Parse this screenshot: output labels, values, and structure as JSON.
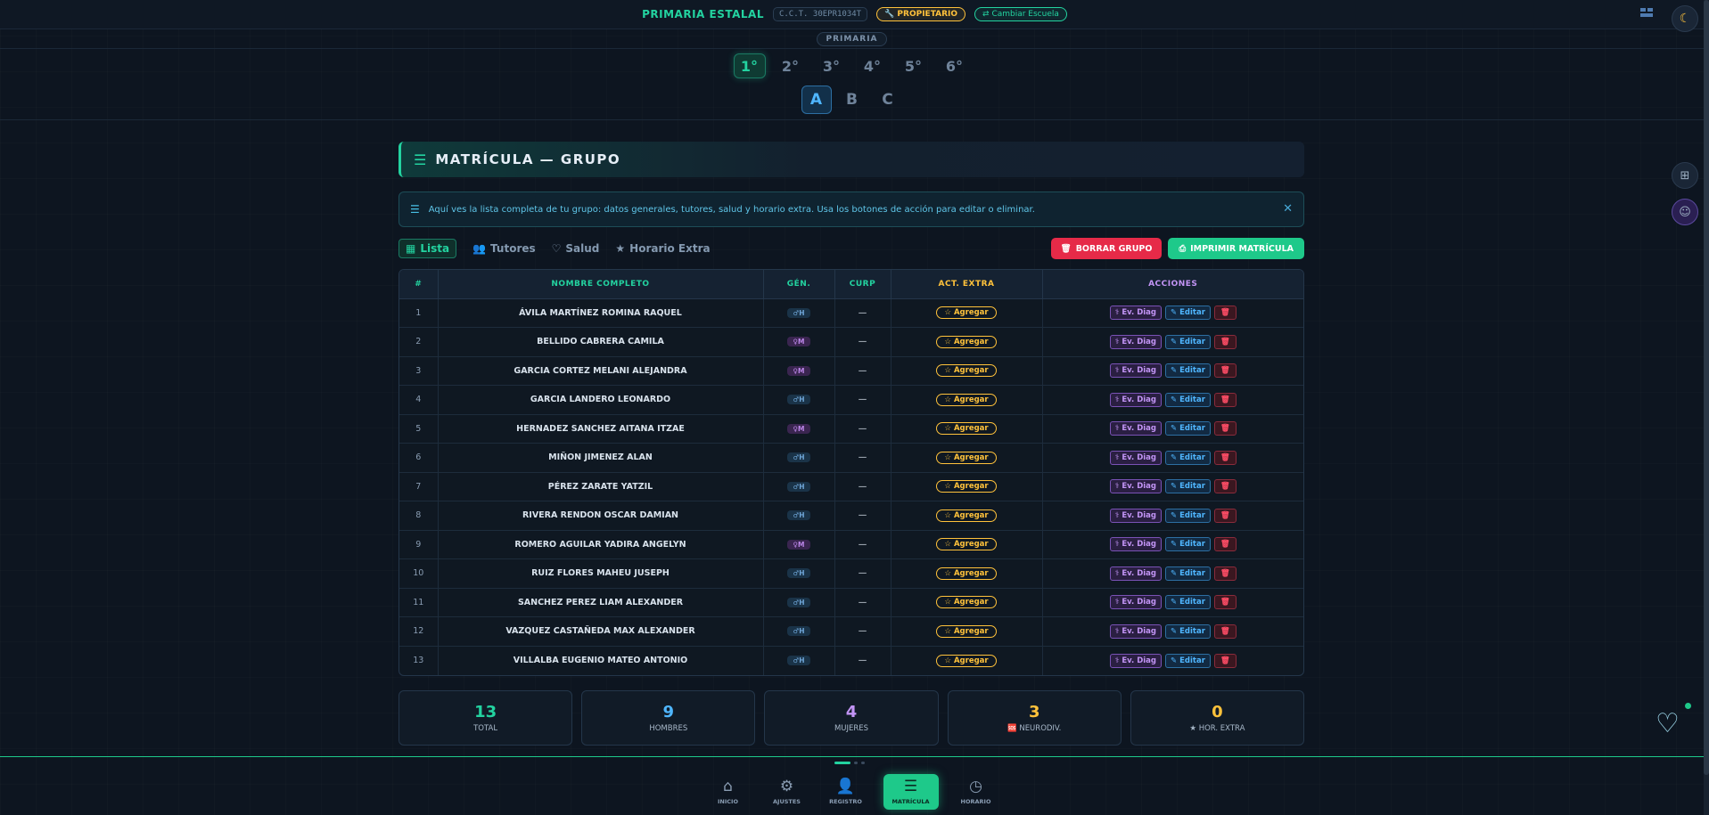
{
  "header": {
    "school_name": "PRIMARIA ESTALAL",
    "cct": "C.C.T. 30EPR1034T",
    "role": "🔧 PROPIETARIO",
    "change_school": "⇄ Cambiar Escuela",
    "theme_icon": "moon-icon"
  },
  "level": "PRIMARIA",
  "grades": [
    "1°",
    "2°",
    "3°",
    "4°",
    "5°",
    "6°"
  ],
  "groups": [
    "A",
    "B",
    "C"
  ],
  "section": {
    "title": "MATRÍCULA — GRUPO",
    "info": "Aquí ves la lista completa de tu grupo: datos generales, tutores, salud y horario extra. Usa los botones de acción para editar o eliminar."
  },
  "tabs": [
    {
      "label": "Lista",
      "icon": "table-icon"
    },
    {
      "label": "Tutores",
      "icon": "users-icon"
    },
    {
      "label": "Salud",
      "icon": "heart-pulse-icon"
    },
    {
      "label": "Horario Extra",
      "icon": "star-icon"
    }
  ],
  "actions": {
    "delete_group": "BORRAR GRUPO",
    "print": "IMPRIMIR MATRÍCULA"
  },
  "table": {
    "headers": [
      "#",
      "NOMBRE COMPLETO",
      "GÉN.",
      "CURP",
      "ACT. EXTRA",
      "ACCIONES"
    ],
    "header_colors": [
      "#23d3a0",
      "#23d3a0",
      "#23d3a0",
      "#23d3a0",
      "#ffc23b",
      "#c294f5"
    ],
    "add_label": "☆ Agregar",
    "ev_label": "Ev. Diag",
    "edit_label": "Editar",
    "rows": [
      {
        "num": "1",
        "name": "ÁVILA MARTÍNEZ ROMINA RAQUEL",
        "gen": "♂H",
        "curp": "—"
      },
      {
        "num": "2",
        "name": "BELLIDO CABRERA CAMILA",
        "gen": "♀M",
        "curp": "—"
      },
      {
        "num": "3",
        "name": "GARCIA CORTEZ MELANI ALEJANDRA",
        "gen": "♀M",
        "curp": "—"
      },
      {
        "num": "4",
        "name": "GARCIA LANDERO LEONARDO",
        "gen": "♂H",
        "curp": "—"
      },
      {
        "num": "5",
        "name": "HERNADEZ SANCHEZ AITANA ITZAE",
        "gen": "♀M",
        "curp": "—"
      },
      {
        "num": "6",
        "name": "MIÑON JIMENEZ ALAN",
        "gen": "♂H",
        "curp": "—"
      },
      {
        "num": "7",
        "name": "PÉREZ ZARATE YATZIL",
        "gen": "♂H",
        "curp": "—"
      },
      {
        "num": "8",
        "name": "RIVERA RENDON OSCAR DAMIAN",
        "gen": "♂H",
        "curp": "—"
      },
      {
        "num": "9",
        "name": "ROMERO AGUILAR YADIRA ANGELYN",
        "gen": "♀M",
        "curp": "—"
      },
      {
        "num": "10",
        "name": "RUIZ FLORES MAHEU JUSEPH",
        "gen": "♂H",
        "curp": "—"
      },
      {
        "num": "11",
        "name": "SANCHEZ PEREZ LIAM ALEXANDER",
        "gen": "♂H",
        "curp": "—"
      },
      {
        "num": "12",
        "name": "VAZQUEZ CASTAÑEDA MAX ALEXANDER",
        "gen": "♂H",
        "curp": "—"
      },
      {
        "num": "13",
        "name": "VILLALBA EUGENIO MATEO ANTONIO",
        "gen": "♂H",
        "curp": "—"
      }
    ]
  },
  "stats": [
    {
      "value": "13",
      "label": "TOTAL",
      "color": "#23d3a0"
    },
    {
      "value": "9",
      "label": "HOMBRES",
      "color": "#4fb6ff"
    },
    {
      "value": "4",
      "label": "MUJERES",
      "color": "#c294f5"
    },
    {
      "value": "3",
      "label": "🆘 NEURODIV.",
      "color": "#ffc23b"
    },
    {
      "value": "0",
      "label": "★ HOR. EXTRA",
      "color": "#ffc23b"
    }
  ],
  "bottom_nav": [
    {
      "label": "INICIO",
      "icon": "home-icon",
      "glyph": "⌂"
    },
    {
      "label": "AJUSTES",
      "icon": "gear-icon",
      "glyph": "⚙"
    },
    {
      "label": "REGISTRO",
      "icon": "add-user-icon",
      "glyph": "👤"
    },
    {
      "label": "MATRÍCULA",
      "icon": "list-icon",
      "glyph": "☰",
      "active": true
    },
    {
      "label": "HORARIO",
      "icon": "clock-icon",
      "glyph": "◷"
    }
  ]
}
